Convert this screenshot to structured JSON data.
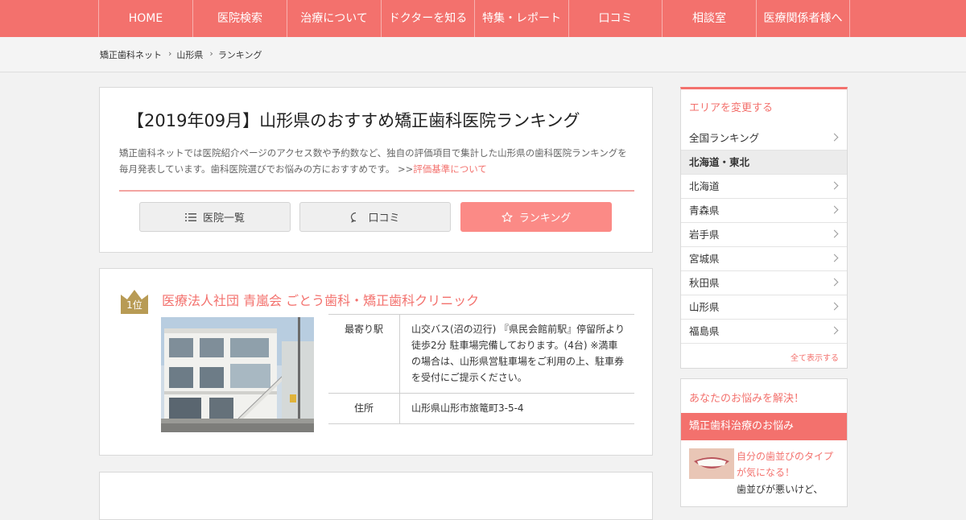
{
  "nav": {
    "items": [
      "HOME",
      "医院検索",
      "治療について",
      "ドクターを知る",
      "特集・レポート",
      "口コミ",
      "相談室",
      "医療関係者様へ"
    ]
  },
  "breadcrumb": [
    "矯正歯科ネット",
    "山形県",
    "ランキング"
  ],
  "intro": {
    "title": "【2019年09月】山形県のおすすめ矯正歯科医院ランキング",
    "description": "矯正歯科ネットでは医院紹介ページのアクセス数や予約数など、独自の評価項目で集計した山形県の歯科医院ランキングを毎月発表しています。歯科医院選びでお悩みの方におすすめです。 >>",
    "criteria_link": "評価基準について",
    "tabs": [
      {
        "label": "医院一覧",
        "icon": "list-icon"
      },
      {
        "label": "口コミ",
        "icon": "chat-icon"
      },
      {
        "label": "ランキング",
        "icon": "star-icon"
      }
    ]
  },
  "clinic": {
    "rank": "1位",
    "name": "医療法人社団 青嵐会 ごとう歯科・矯正歯科クリニック",
    "station_label": "最寄り駅",
    "station_value": "山交バス(沼の辺行) 『県民会館前駅』停留所より徒歩2分 駐車場完備しております。(4台) ※満車の場合は、山形県営駐車場をご利用の上、駐車券を受付にご提示ください。",
    "address_label": "住所",
    "address_value": "山形県山形市旅篭町3-5-4"
  },
  "sidebar": {
    "area_title": "エリアを変更する",
    "areas": [
      "全国ランキング",
      "北海道・東北",
      "北海道",
      "青森県",
      "岩手県",
      "宮城県",
      "秋田県",
      "山形県",
      "福島県"
    ],
    "selected_area": "北海道・東北",
    "show_all": "全て表示する",
    "worry_title": "あなたのお悩みを解決！",
    "worry_band": "矯正歯科治療のお悩み",
    "worry_link": "自分の歯並びのタイプが気になる！",
    "worry_text": "歯並びが悪いけど、"
  },
  "colors": {
    "accent": "#f3716d",
    "active_tab": "#fb8a86",
    "page_bg": "#f2f2f2"
  }
}
